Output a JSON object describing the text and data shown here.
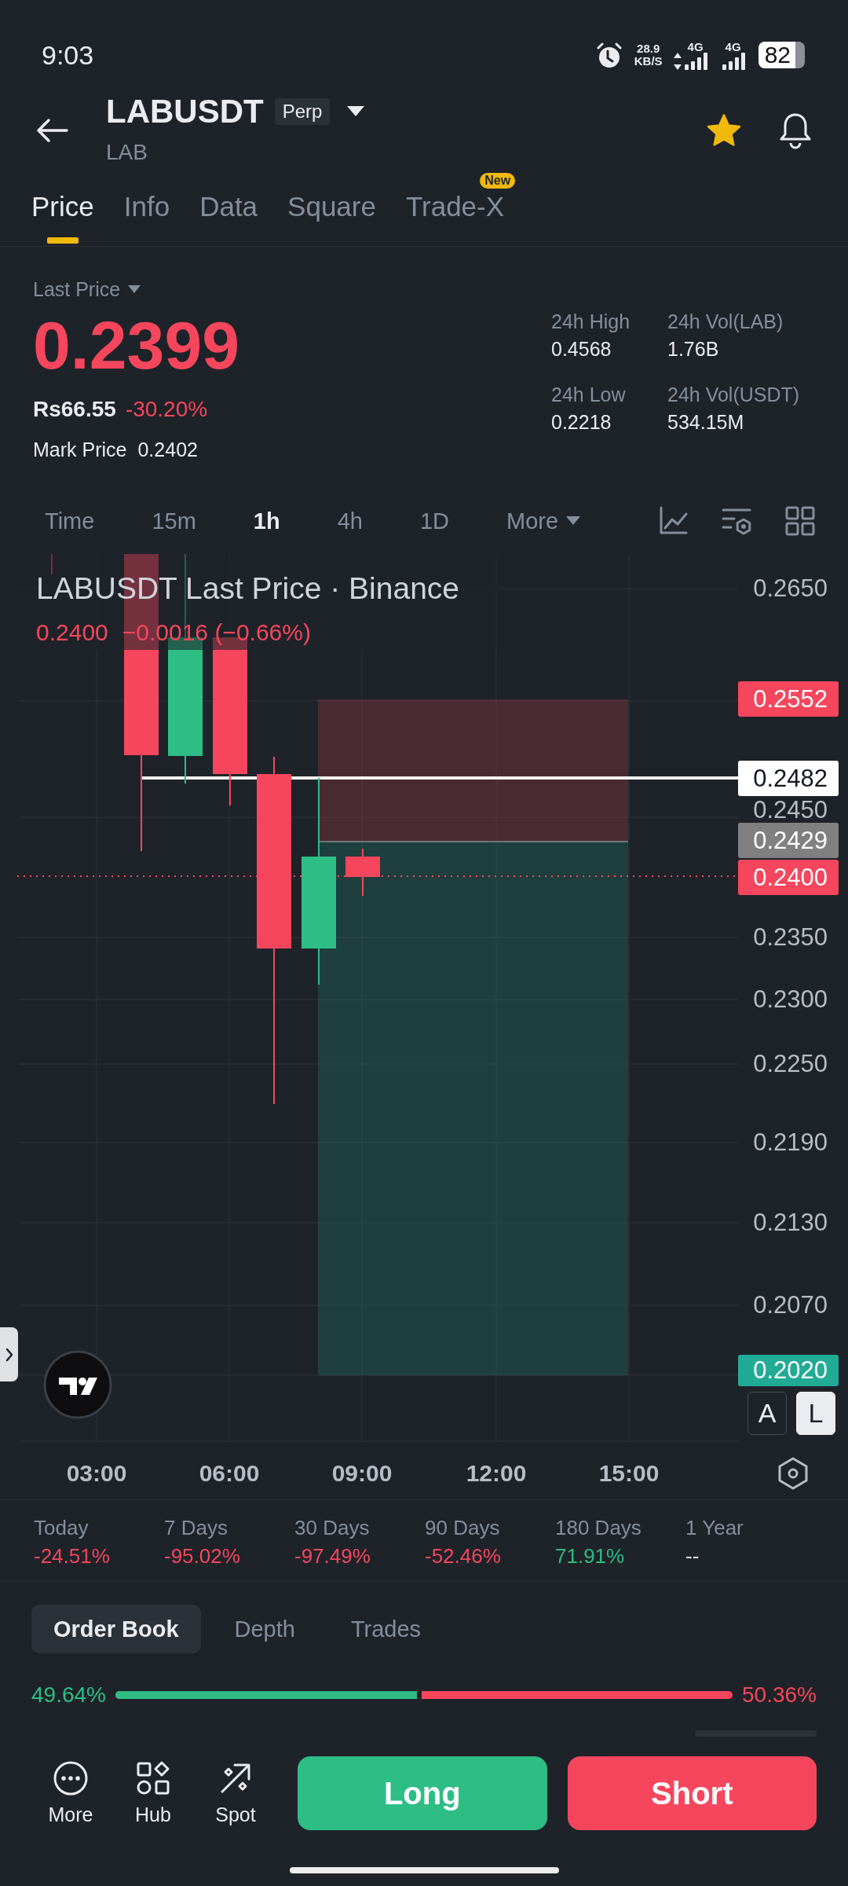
{
  "status_bar": {
    "time": "9:03",
    "speed_value": "28.9",
    "speed_unit": "KB/S",
    "networks": [
      {
        "label": "4G",
        "kind": "transfer"
      },
      {
        "label": "4G",
        "kind": "idle"
      }
    ],
    "battery": "82"
  },
  "header": {
    "symbol": "LABUSDT",
    "badge": "Perp",
    "subtitle": "LAB",
    "favorite": true
  },
  "tabs": [
    {
      "label": "Price",
      "selected": true
    },
    {
      "label": "Info",
      "selected": false
    },
    {
      "label": "Data",
      "selected": false
    },
    {
      "label": "Square",
      "selected": false
    },
    {
      "label": "Trade-X",
      "selected": false,
      "badge": "New"
    }
  ],
  "price_panel": {
    "label": "Last Price",
    "value": "0.2399",
    "fiat_value": "Rs66.55",
    "change": "-30.20%",
    "mark_label": "Mark Price",
    "mark_value": "0.2402",
    "stats": [
      {
        "label": "24h High",
        "value": "0.4568"
      },
      {
        "label": "24h Vol(LAB)",
        "value": "1.76B"
      },
      {
        "label": "24h Low",
        "value": "0.2218"
      },
      {
        "label": "24h Vol(USDT)",
        "value": "534.15M"
      }
    ]
  },
  "chart_toolbar": {
    "intervals": [
      {
        "label": "Time",
        "selected": false
      },
      {
        "label": "15m",
        "selected": false
      },
      {
        "label": "1h",
        "selected": true
      },
      {
        "label": "4h",
        "selected": false
      },
      {
        "label": "1D",
        "selected": false
      }
    ],
    "more": "More"
  },
  "chart": {
    "legend": {
      "title": "LABUSDT Last Price · Binance",
      "price": "0.2400",
      "change": "−0.0016 (−0.66%)"
    },
    "price_axis": [
      "0.2650",
      "0.2450",
      "0.2350",
      "0.2300",
      "0.2250",
      "0.2190",
      "0.2130",
      "0.2070"
    ],
    "price_tags": [
      {
        "value": "0.2552",
        "color": "#f6465d"
      },
      {
        "value": "0.2482",
        "color": "#ffffff"
      },
      {
        "value": "0.2429",
        "color": "#808080"
      },
      {
        "value": "0.2400",
        "color": "#f6465d"
      },
      {
        "value": "0.2020",
        "color": "#22ab94"
      }
    ],
    "time_axis": [
      "03:00",
      "06:00",
      "09:00",
      "12:00",
      "15:00"
    ],
    "scale_modes": [
      {
        "label": "A",
        "selected": false
      },
      {
        "label": "L",
        "selected": true
      }
    ]
  },
  "period_changes": [
    {
      "label": "Today",
      "value": "-24.51%",
      "color": "#f6465d"
    },
    {
      "label": "7 Days",
      "value": "-95.02%",
      "color": "#f6465d"
    },
    {
      "label": "30 Days",
      "value": "-97.49%",
      "color": "#f6465d"
    },
    {
      "label": "90 Days",
      "value": "-52.46%",
      "color": "#f6465d"
    },
    {
      "label": "180 Days",
      "value": "71.91%",
      "color": "#2ebd85"
    },
    {
      "label": "1 Year",
      "value": "--",
      "color": "#eaecef"
    }
  ],
  "order_tabs": [
    {
      "label": "Order Book",
      "selected": true
    },
    {
      "label": "Depth",
      "selected": false
    },
    {
      "label": "Trades",
      "selected": false
    }
  ],
  "order_ratio": {
    "buy": "49.64%",
    "sell": "50.36%",
    "level": 0.4964
  },
  "bottom_bar": {
    "shortcuts": [
      {
        "label": "More",
        "kind": "more"
      },
      {
        "label": "Hub",
        "kind": "hub"
      },
      {
        "label": "Spot",
        "kind": "spot"
      }
    ],
    "actions": [
      {
        "label": "Long",
        "kind": "long"
      },
      {
        "label": "Short",
        "kind": "short"
      }
    ]
  }
}
